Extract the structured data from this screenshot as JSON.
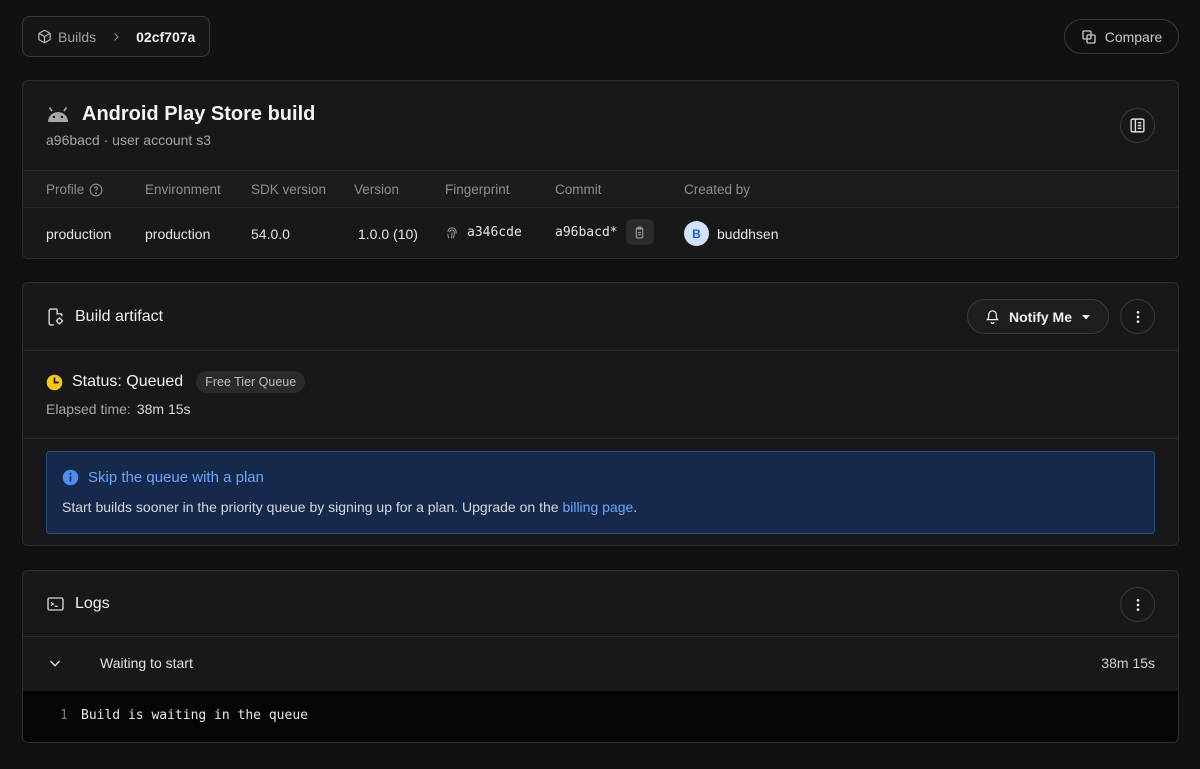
{
  "breadcrumb": {
    "parent": "Builds",
    "current": "02cf707a"
  },
  "compare_label": "Compare",
  "build": {
    "title": "Android Play Store build",
    "subtitle": "a96bacd · user account s3",
    "meta_headers": [
      "Profile",
      "Environment",
      "SDK version",
      "Version",
      "Fingerprint",
      "Commit",
      "Created by"
    ],
    "profile": "production",
    "environment": "production",
    "sdk_version": "54.0.0",
    "version": "1.0.0 (10)",
    "fingerprint": "a346cde",
    "commit": "a96bacd*",
    "created_by": "buddhsen",
    "avatar_initial": "B"
  },
  "artifact": {
    "title": "Build artifact",
    "notify_label": "Notify Me",
    "status": "Status: Queued",
    "queue_badge": "Free Tier Queue",
    "elapsed_label": "Elapsed time:",
    "elapsed_value": "38m 15s",
    "callout": {
      "title": "Skip the queue with a plan",
      "body": "Start builds sooner in the priority queue by signing up for a plan. Upgrade on the ",
      "link": "billing page",
      "tail": "."
    }
  },
  "logs": {
    "title": "Logs",
    "step_label": "Waiting to start",
    "step_time": "38m 15s",
    "line_number": "1",
    "line_text": "Build is waiting in the queue"
  },
  "colors": {
    "accent_blue": "#6aa6ff",
    "status_yellow": "#f5c518",
    "callout_bg": "#15294a"
  }
}
